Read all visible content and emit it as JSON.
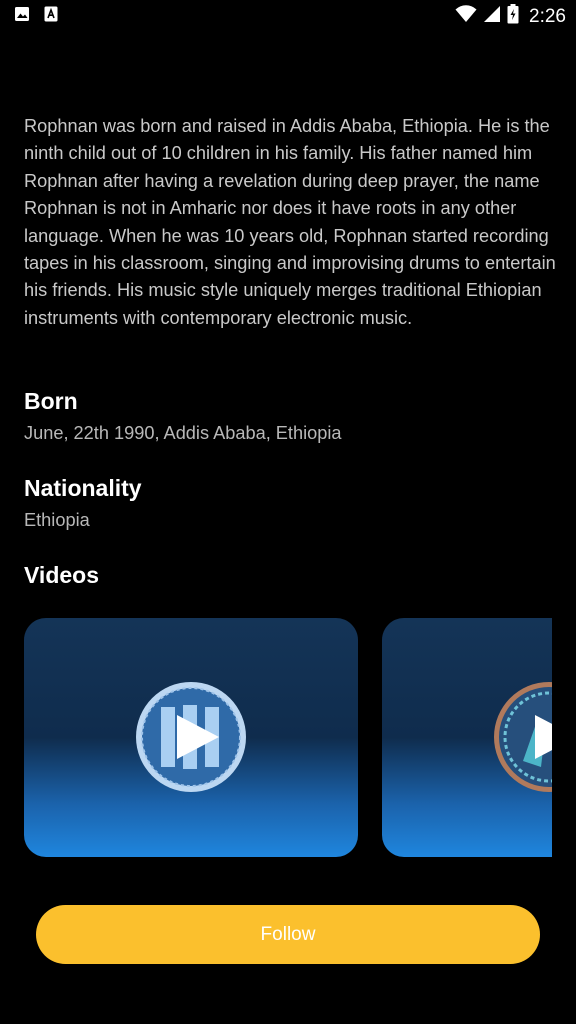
{
  "status_bar": {
    "time": "2:26",
    "icons": [
      "image-icon",
      "a-icon",
      "wifi-icon",
      "signal-icon",
      "battery-charging-icon"
    ]
  },
  "artist": {
    "bio": "Rophnan was born and raised in Addis Ababa, Ethiopia. He is the ninth child out of 10 children in his family. His father named him Rophnan after having a revelation during deep prayer, the name Rophnan is not in Amharic nor does it have roots in any other language. When he was 10 years old, Rophnan started recording tapes in his classroom, singing and improvising drums to entertain his friends. His music style uniquely merges traditional Ethiopian instruments with contemporary electronic music."
  },
  "born": {
    "label": "Born",
    "value": "June, 22th 1990, Addis Ababa, Ethiopia"
  },
  "nationality": {
    "label": "Nationality",
    "value": "Ethiopia"
  },
  "videos": {
    "label": "Videos",
    "items": [
      {
        "thumbnail": "play-logo-icon"
      },
      {
        "thumbnail": "play-logo-icon"
      }
    ]
  },
  "follow_button": {
    "label": "Follow"
  },
  "colors": {
    "background": "#000000",
    "accent": "#fbc02d",
    "card_top": "#143457",
    "card_bottom": "#1f86de"
  }
}
